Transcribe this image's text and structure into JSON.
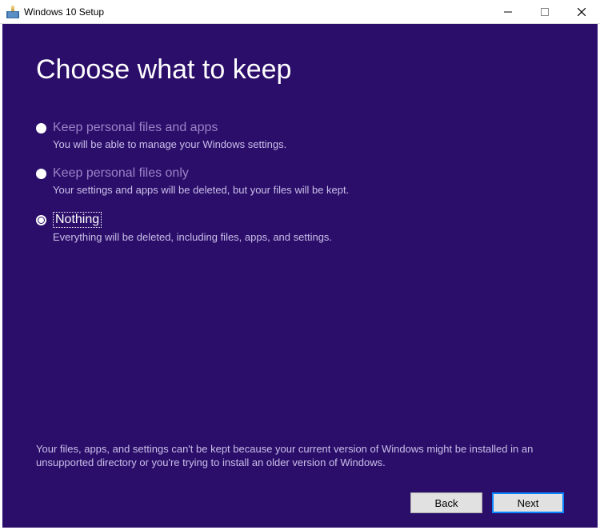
{
  "window": {
    "title": "Windows 10 Setup"
  },
  "page": {
    "heading": "Choose what to keep",
    "options": [
      {
        "label": "Keep personal files and apps",
        "description": "You will be able to manage your Windows settings.",
        "enabled": false,
        "selected": false
      },
      {
        "label": "Keep personal files only",
        "description": "Your settings and apps will be deleted, but your files will be kept.",
        "enabled": false,
        "selected": false
      },
      {
        "label": "Nothing",
        "description": "Everything will be deleted, including files, apps, and settings.",
        "enabled": true,
        "selected": true
      }
    ],
    "footnote": "Your files, apps, and settings can't be kept because your current version of Windows might be installed in an unsupported directory or you're trying to install an older version of Windows."
  },
  "buttons": {
    "back": "Back",
    "next": "Next"
  }
}
